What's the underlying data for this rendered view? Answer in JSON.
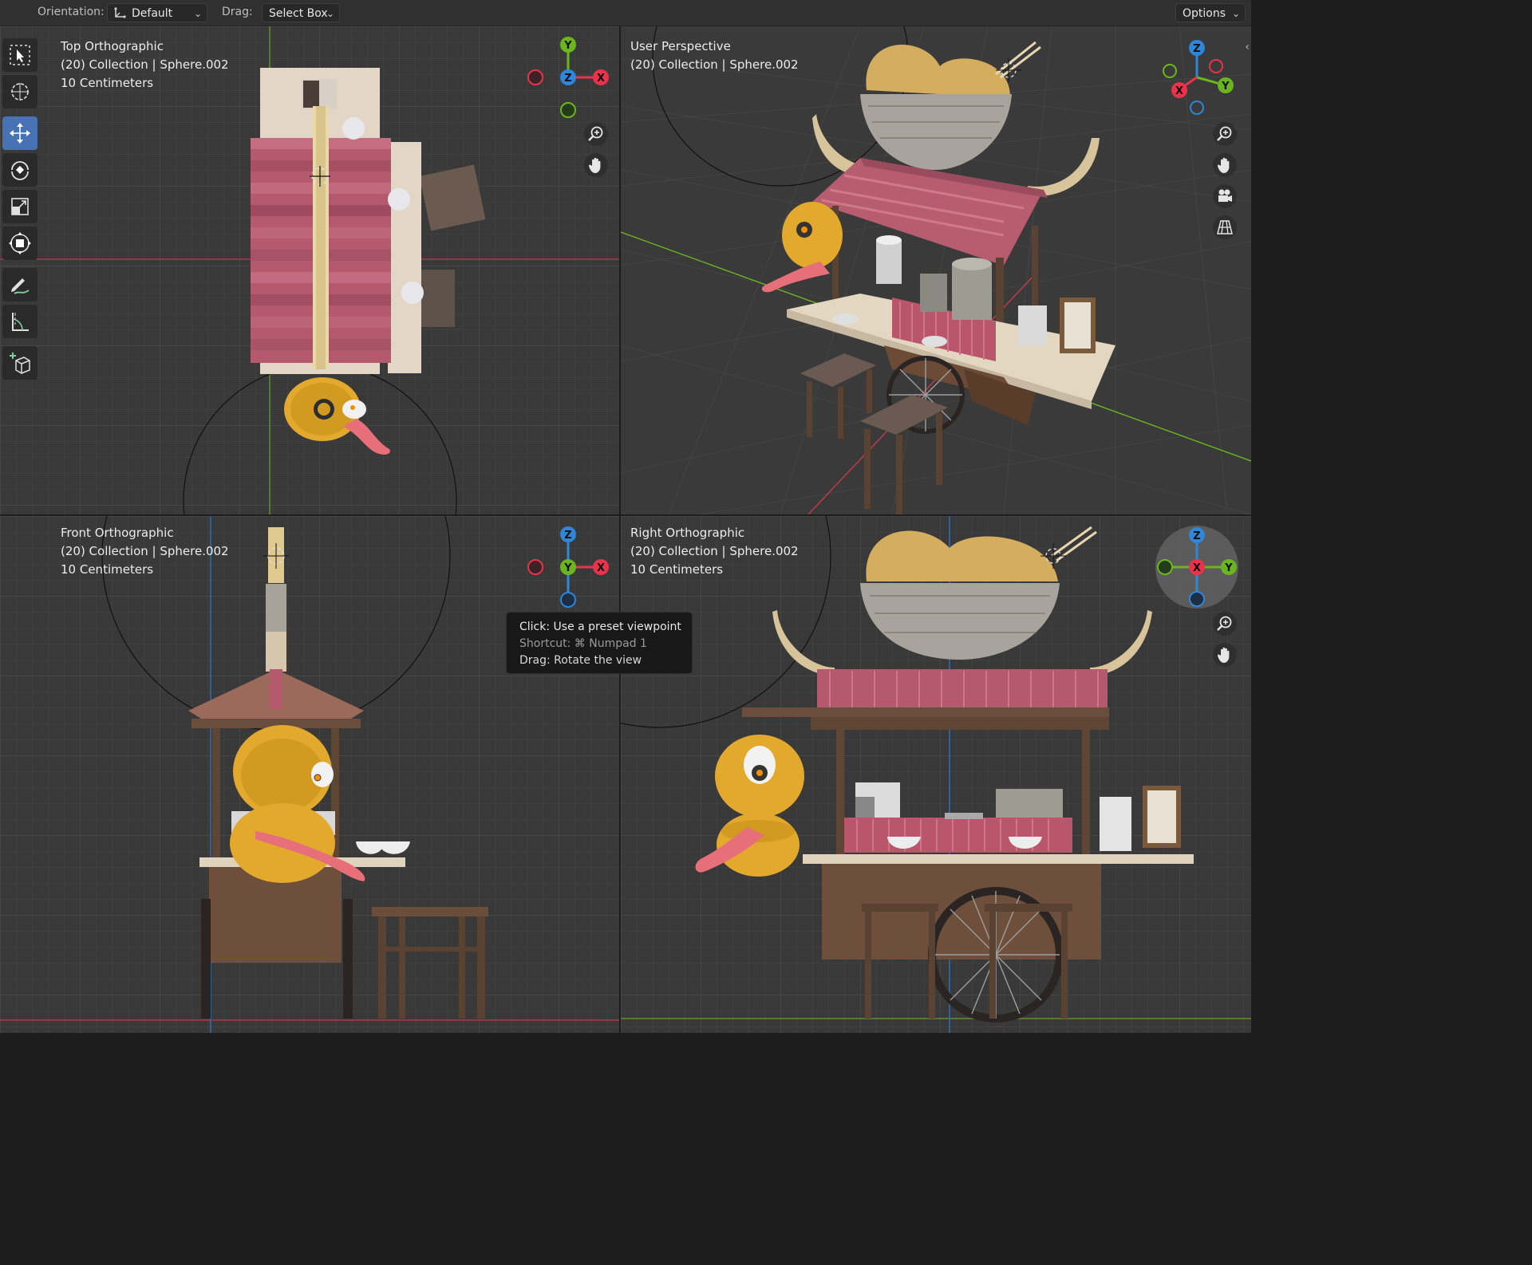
{
  "header": {
    "orientation_label": "Orientation:",
    "orientation_value": "Default",
    "drag_label": "Drag:",
    "drag_value": "Select Box",
    "options_label": "Options"
  },
  "viewports": [
    {
      "view_name": "Top Orthographic",
      "collection": "(20) Collection | Sphere.002",
      "scale": "10 Centimeters"
    },
    {
      "view_name": "User Perspective",
      "collection": "(20) Collection | Sphere.002"
    },
    {
      "view_name": "Front Orthographic",
      "collection": "(20) Collection | Sphere.002",
      "scale": "10 Centimeters"
    },
    {
      "view_name": "Right Orthographic",
      "collection": "(20) Collection | Sphere.002",
      "scale": "10 Centimeters"
    }
  ],
  "gizmo_axes": {
    "x": "X",
    "y": "Y",
    "z": "Z"
  },
  "tooltip": {
    "line1": "Click: Use a preset viewpoint",
    "line2": "Shortcut: ⌘ Numpad 1",
    "line3": "Drag: Rotate the view"
  },
  "tools": [
    "select-box-icon",
    "cursor-icon",
    "move-icon",
    "rotate-icon",
    "scale-icon",
    "transform-icon",
    "annotate-icon",
    "measure-icon",
    "add-cube-icon"
  ],
  "colors": {
    "x_axis": "#e8334a",
    "y_axis": "#6bb61f",
    "z_axis": "#2f86d9",
    "active_tool": "#4772b3"
  }
}
